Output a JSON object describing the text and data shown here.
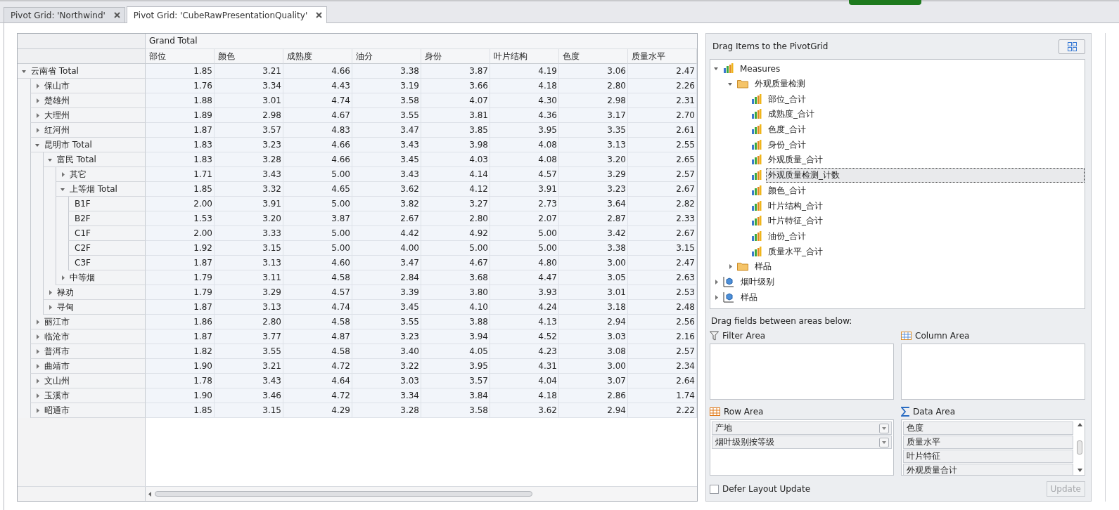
{
  "tabs": [
    {
      "label": "Pivot Grid: 'Northwind'",
      "selected": false
    },
    {
      "label": "Pivot Grid: 'CubeRawPresentationQuality'",
      "selected": true
    }
  ],
  "pivot": {
    "grand_total": "Grand Total",
    "columns": [
      "部位",
      "颜色",
      "成熟度",
      "油分",
      "身份",
      "叶片结构",
      "色度",
      "质量水平"
    ],
    "rows": [
      {
        "label": "云南省 Total",
        "expanded": true,
        "values": [
          "1.85",
          "3.21",
          "4.66",
          "3.38",
          "3.87",
          "4.19",
          "3.06",
          "2.47"
        ],
        "children": [
          {
            "label": "保山市",
            "expanded": false,
            "values": [
              "1.76",
              "3.34",
              "4.43",
              "3.19",
              "3.66",
              "4.18",
              "2.80",
              "2.26"
            ]
          },
          {
            "label": "楚雄州",
            "expanded": false,
            "values": [
              "1.88",
              "3.01",
              "4.74",
              "3.58",
              "4.07",
              "4.30",
              "2.98",
              "2.31"
            ]
          },
          {
            "label": "大理州",
            "expanded": false,
            "values": [
              "1.89",
              "2.98",
              "4.67",
              "3.55",
              "3.81",
              "4.36",
              "3.17",
              "2.70"
            ]
          },
          {
            "label": "红河州",
            "expanded": false,
            "values": [
              "1.87",
              "3.57",
              "4.83",
              "3.47",
              "3.85",
              "3.95",
              "3.35",
              "2.61"
            ]
          },
          {
            "label": "昆明市 Total",
            "expanded": true,
            "values": [
              "1.83",
              "3.23",
              "4.66",
              "3.43",
              "3.98",
              "4.08",
              "3.13",
              "2.55"
            ],
            "children": [
              {
                "label": "富民 Total",
                "expanded": true,
                "values": [
                  "1.83",
                  "3.28",
                  "4.66",
                  "3.45",
                  "4.03",
                  "4.08",
                  "3.20",
                  "2.65"
                ],
                "children": [
                  {
                    "label": "其它",
                    "expanded": false,
                    "values": [
                      "1.71",
                      "3.43",
                      "5.00",
                      "3.43",
                      "4.14",
                      "4.57",
                      "3.29",
                      "2.57"
                    ]
                  },
                  {
                    "label": "上等烟 Total",
                    "expanded": true,
                    "values": [
                      "1.85",
                      "3.32",
                      "4.65",
                      "3.62",
                      "4.12",
                      "3.91",
                      "3.23",
                      "2.67"
                    ],
                    "children": [
                      {
                        "label": "B1F",
                        "values": [
                          "2.00",
                          "3.91",
                          "5.00",
                          "3.82",
                          "3.27",
                          "2.73",
                          "3.64",
                          "2.82"
                        ]
                      },
                      {
                        "label": "B2F",
                        "values": [
                          "1.53",
                          "3.20",
                          "3.87",
                          "2.67",
                          "2.80",
                          "2.07",
                          "2.87",
                          "2.33"
                        ]
                      },
                      {
                        "label": "C1F",
                        "values": [
                          "2.00",
                          "3.33",
                          "5.00",
                          "4.42",
                          "4.92",
                          "5.00",
                          "3.42",
                          "2.67"
                        ]
                      },
                      {
                        "label": "C2F",
                        "values": [
                          "1.92",
                          "3.15",
                          "5.00",
                          "4.00",
                          "5.00",
                          "5.00",
                          "3.38",
                          "3.15"
                        ]
                      },
                      {
                        "label": "C3F",
                        "values": [
                          "1.87",
                          "3.13",
                          "4.60",
                          "3.47",
                          "4.67",
                          "4.80",
                          "3.00",
                          "2.47"
                        ]
                      }
                    ]
                  },
                  {
                    "label": "中等烟",
                    "expanded": false,
                    "values": [
                      "1.79",
                      "3.11",
                      "4.58",
                      "2.84",
                      "3.68",
                      "4.47",
                      "3.05",
                      "2.63"
                    ]
                  }
                ]
              },
              {
                "label": "禄劝",
                "expanded": false,
                "values": [
                  "1.79",
                  "3.29",
                  "4.57",
                  "3.39",
                  "3.80",
                  "3.93",
                  "3.01",
                  "2.53"
                ]
              },
              {
                "label": "寻甸",
                "expanded": false,
                "values": [
                  "1.87",
                  "3.13",
                  "4.74",
                  "3.45",
                  "4.10",
                  "4.24",
                  "3.18",
                  "2.48"
                ]
              }
            ]
          },
          {
            "label": "丽江市",
            "expanded": false,
            "values": [
              "1.86",
              "2.80",
              "4.58",
              "3.55",
              "3.88",
              "4.13",
              "2.94",
              "2.56"
            ]
          },
          {
            "label": "临沧市",
            "expanded": false,
            "values": [
              "1.87",
              "3.77",
              "4.87",
              "3.23",
              "3.94",
              "4.52",
              "3.03",
              "2.16"
            ]
          },
          {
            "label": "普洱市",
            "expanded": false,
            "values": [
              "1.82",
              "3.55",
              "4.58",
              "3.40",
              "4.05",
              "4.23",
              "3.08",
              "2.57"
            ]
          },
          {
            "label": "曲靖市",
            "expanded": false,
            "values": [
              "1.90",
              "3.21",
              "4.72",
              "3.22",
              "3.95",
              "4.31",
              "3.00",
              "2.34"
            ]
          },
          {
            "label": "文山州",
            "expanded": false,
            "values": [
              "1.78",
              "3.43",
              "4.64",
              "3.03",
              "3.57",
              "4.04",
              "3.07",
              "2.64"
            ]
          },
          {
            "label": "玉溪市",
            "expanded": false,
            "values": [
              "1.90",
              "3.46",
              "4.72",
              "3.34",
              "3.84",
              "4.18",
              "2.86",
              "1.74"
            ]
          },
          {
            "label": "昭通市",
            "expanded": false,
            "values": [
              "1.85",
              "3.15",
              "4.29",
              "3.28",
              "3.58",
              "3.62",
              "2.94",
              "2.22"
            ]
          }
        ]
      }
    ]
  },
  "field_list": {
    "title": "Drag Items to the PivotGrid",
    "items": [
      {
        "label": "Measures",
        "kind": "measures",
        "expanded": true,
        "selected": false,
        "children": [
          {
            "label": "外观质量检测",
            "kind": "folder",
            "expanded": true,
            "selected": false,
            "children": [
              {
                "label": "部位_合计",
                "kind": "measure",
                "selected": false
              },
              {
                "label": "成熟度_合计",
                "kind": "measure",
                "selected": false
              },
              {
                "label": "色度_合计",
                "kind": "measure",
                "selected": false
              },
              {
                "label": "身份_合计",
                "kind": "measure",
                "selected": false
              },
              {
                "label": "外观质量_合计",
                "kind": "measure",
                "selected": false
              },
              {
                "label": "外观质量检测_计数",
                "kind": "measure",
                "selected": true
              },
              {
                "label": "颜色_合计",
                "kind": "measure",
                "selected": false
              },
              {
                "label": "叶片结构_合计",
                "kind": "measure",
                "selected": false
              },
              {
                "label": "叶片特征_合计",
                "kind": "measure",
                "selected": false
              },
              {
                "label": "油份_合计",
                "kind": "measure",
                "selected": false
              },
              {
                "label": "质量水平_合计",
                "kind": "measure",
                "selected": false
              }
            ]
          },
          {
            "label": "样品",
            "kind": "folder",
            "expanded": false,
            "selected": false
          }
        ]
      },
      {
        "label": "烟叶级别",
        "kind": "dimension",
        "expanded": false,
        "selected": false
      },
      {
        "label": "样品",
        "kind": "dimension",
        "expanded": false,
        "selected": false
      }
    ],
    "areas_hint": "Drag fields between areas below:",
    "filter_area": {
      "title": "Filter Area"
    },
    "column_area": {
      "title": "Column Area"
    },
    "row_area": {
      "title": "Row Area",
      "fields": [
        "产地",
        "烟叶级别按等级"
      ]
    },
    "data_area": {
      "title": "Data Area",
      "fields": [
        "色度",
        "质量水平",
        "叶片特征",
        "外观质量合计"
      ]
    },
    "defer_layout_update": {
      "label": "Defer Layout Update",
      "checked": false
    },
    "update_button": {
      "label": "Update",
      "disabled": true
    }
  }
}
